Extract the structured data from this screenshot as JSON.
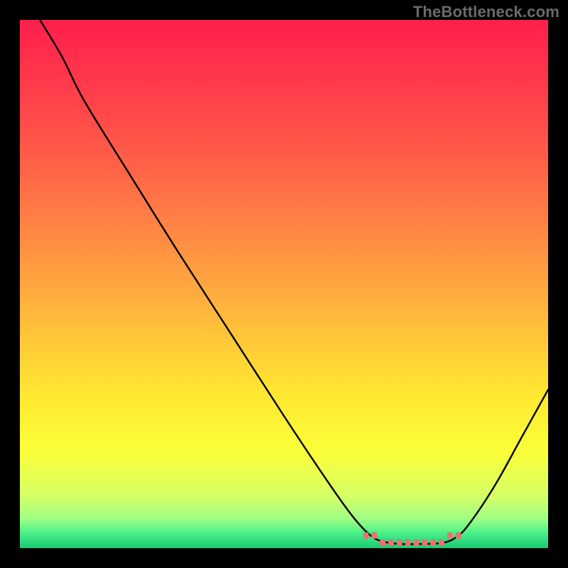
{
  "watermark": "TheBottleneck.com",
  "chart_data": {
    "type": "line",
    "title": "",
    "xlabel": "",
    "ylabel": "",
    "xlim": [
      0,
      100
    ],
    "ylim": [
      0,
      100
    ],
    "annotations": [],
    "curve": {
      "name": "bottleneck-curve",
      "points": [
        {
          "x": 3.8,
          "y": 100
        },
        {
          "x": 8,
          "y": 93
        },
        {
          "x": 12,
          "y": 85
        },
        {
          "x": 20,
          "y": 72
        },
        {
          "x": 30,
          "y": 56
        },
        {
          "x": 40,
          "y": 40.5
        },
        {
          "x": 50,
          "y": 25
        },
        {
          "x": 58,
          "y": 13
        },
        {
          "x": 63,
          "y": 6
        },
        {
          "x": 66.5,
          "y": 2.3
        },
        {
          "x": 69,
          "y": 1.2
        },
        {
          "x": 72,
          "y": 0.8
        },
        {
          "x": 76,
          "y": 0.8
        },
        {
          "x": 80,
          "y": 1.0
        },
        {
          "x": 82.5,
          "y": 2.0
        },
        {
          "x": 85,
          "y": 4.5
        },
        {
          "x": 90,
          "y": 12
        },
        {
          "x": 95,
          "y": 21
        },
        {
          "x": 100,
          "y": 30
        }
      ]
    },
    "marker_zone": {
      "x_start": 65.5,
      "x_end": 83,
      "count": 12,
      "y_base": 1.1,
      "color": "#e7736f"
    },
    "gradient_stops": [
      {
        "offset": 0.0,
        "color": "#ff1f4b"
      },
      {
        "offset": 0.12,
        "color": "#ff3a4b"
      },
      {
        "offset": 0.25,
        "color": "#ff5a48"
      },
      {
        "offset": 0.4,
        "color": "#ff8744"
      },
      {
        "offset": 0.55,
        "color": "#ffb63c"
      },
      {
        "offset": 0.7,
        "color": "#ffe531"
      },
      {
        "offset": 0.82,
        "color": "#faff3a"
      },
      {
        "offset": 0.9,
        "color": "#d6ff66"
      },
      {
        "offset": 0.945,
        "color": "#9eff86"
      },
      {
        "offset": 0.97,
        "color": "#4df289"
      },
      {
        "offset": 1.0,
        "color": "#18c978"
      }
    ]
  }
}
